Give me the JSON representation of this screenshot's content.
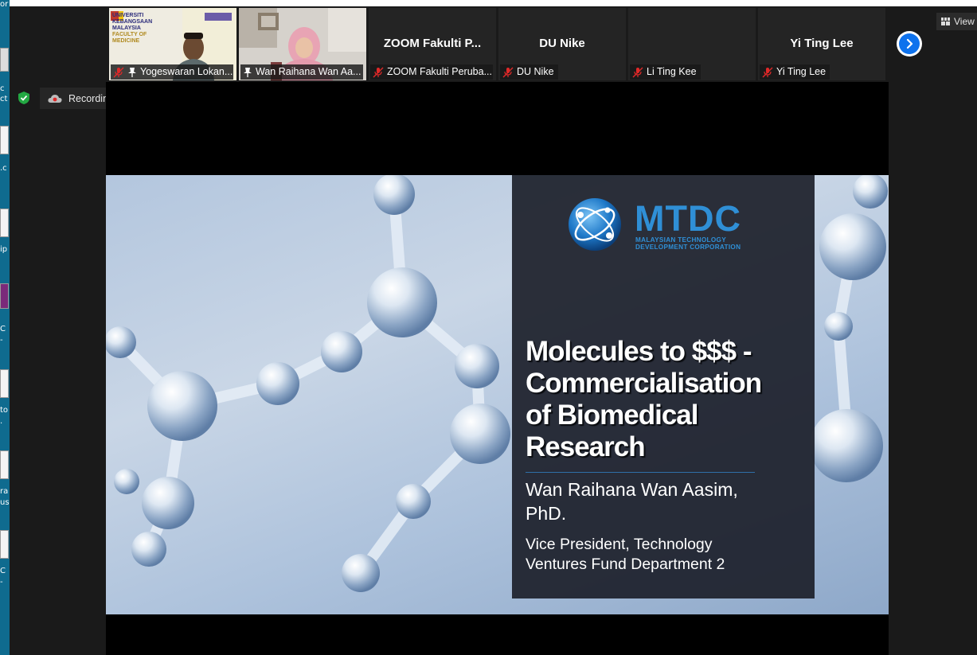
{
  "desktop": {
    "labels": [
      "or",
      "c",
      "ct",
      ".c",
      "ip",
      "C",
      "-",
      "to",
      ".",
      "ra",
      "us.",
      "C",
      "-"
    ]
  },
  "gallery": {
    "tiles": [
      {
        "type": "video",
        "display_name": "",
        "footer": "Yogeswaran Lokan...",
        "muted": true,
        "pinned": true,
        "backdrop_text": [
          "UNIVERSITI",
          "KEBANGSAAN",
          "MALAYSIA",
          "FACULTY OF MEDICINE"
        ]
      },
      {
        "type": "video",
        "display_name": "",
        "footer": "Wan Raihana Wan Aa...",
        "muted": false,
        "pinned": true,
        "active": true
      },
      {
        "type": "name",
        "display_name": "ZOOM  Fakulti  P...",
        "footer": "ZOOM Fakulti Peruba...",
        "muted": true
      },
      {
        "type": "name",
        "display_name": "DU Nike",
        "footer": "DU Nike",
        "muted": true
      },
      {
        "type": "name",
        "display_name": "",
        "footer": "Li Ting Kee",
        "muted": true
      },
      {
        "type": "name",
        "display_name": "Yi Ting Lee",
        "footer": "Yi Ting Lee",
        "muted": true
      }
    ],
    "next_icon": "chevron-right-icon"
  },
  "view_button": {
    "label": "View",
    "icon": "grid-icon"
  },
  "recording": {
    "status": "Recording..."
  },
  "slide": {
    "logo_text": "MTDC",
    "logo_sub_line1": "MALAYSIAN TECHNOLOGY",
    "logo_sub_line2": "DEVELOPMENT CORPORATION",
    "title_lines": [
      "Molecules to $$$ -",
      "Commercialisation",
      "of Biomedical",
      "Research"
    ],
    "presenter_lines": [
      "Wan Raihana Wan Aasim,",
      "PhD."
    ],
    "role_lines": [
      "Vice President, Technology",
      "Ventures Fund Department 2"
    ]
  },
  "colors": {
    "accent": "#0e72ed",
    "logo_blue": "#2f8fd6",
    "active_speaker": "#4a7d2e",
    "muted_red": "#e02828"
  }
}
